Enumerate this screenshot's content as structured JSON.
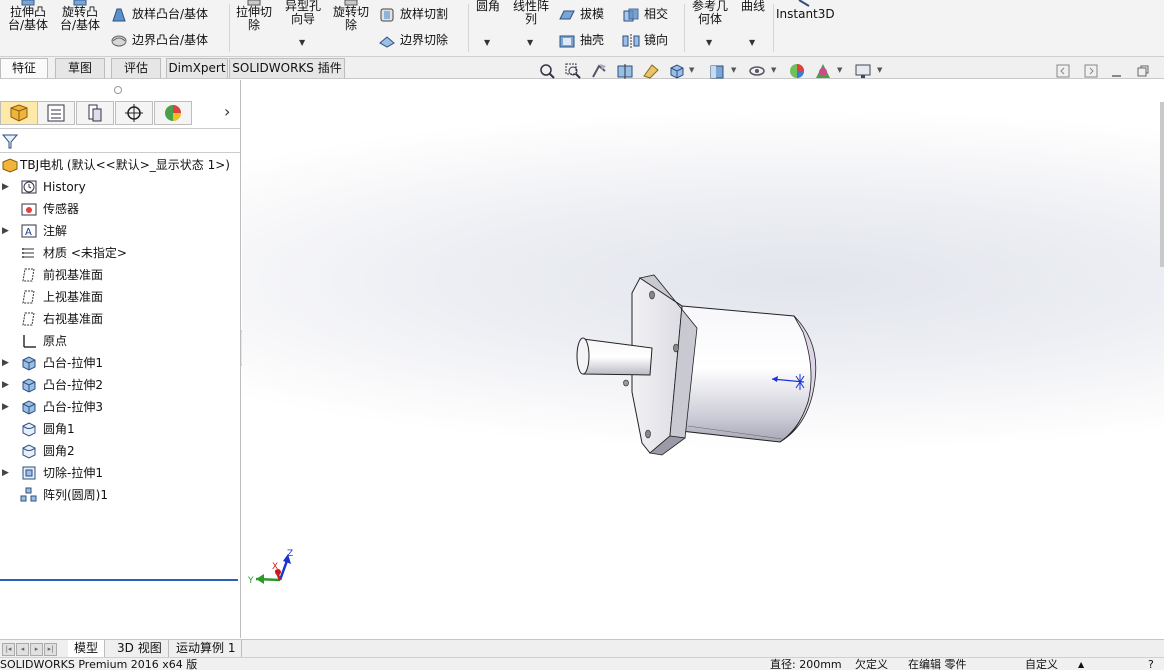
{
  "ribbon": {
    "extrude_boss": "拉伸凸台/基体",
    "revolve_boss": "旋转凸台/基体",
    "loft_boss": "放样凸台/基体",
    "boundary_boss": "边界凸台/基体",
    "extrude_cut": "拉伸切除",
    "hole_wizard": "异型孔向导",
    "revolve_cut": "旋转切除",
    "loft_cut": "放样切割",
    "boundary_cut": "边界切除",
    "fillet": "圆角",
    "linear_pattern": "线性阵列",
    "draft": "拔模",
    "shell": "抽壳",
    "intersect": "相交",
    "mirror": "镜向",
    "reference_geometry": "参考几何体",
    "curves": "曲线",
    "instant3d": "Instant3D"
  },
  "command_tabs": [
    "特征",
    "草图",
    "评估",
    "DimXpert",
    "SOLIDWORKS 插件"
  ],
  "feature_manager": {
    "root": "TBJ电机 (默认<<默认>_显示状态 1>)",
    "items": [
      {
        "label": "History",
        "expandable": true,
        "icon": "history-icon"
      },
      {
        "label": "传感器",
        "expandable": false,
        "icon": "sensor-icon"
      },
      {
        "label": "注解",
        "expandable": true,
        "icon": "annotation-icon"
      },
      {
        "label": "材质 <未指定>",
        "expandable": false,
        "icon": "material-icon"
      },
      {
        "label": "前视基准面",
        "expandable": false,
        "icon": "plane-icon"
      },
      {
        "label": "上视基准面",
        "expandable": false,
        "icon": "plane-icon"
      },
      {
        "label": "右视基准面",
        "expandable": false,
        "icon": "plane-icon"
      },
      {
        "label": "原点",
        "expandable": false,
        "icon": "origin-icon"
      },
      {
        "label": "凸台-拉伸1",
        "expandable": true,
        "icon": "boss-extrude-icon"
      },
      {
        "label": "凸台-拉伸2",
        "expandable": true,
        "icon": "boss-extrude-icon"
      },
      {
        "label": "凸台-拉伸3",
        "expandable": true,
        "icon": "boss-extrude-icon"
      },
      {
        "label": "圆角1",
        "expandable": false,
        "icon": "fillet-icon"
      },
      {
        "label": "圆角2",
        "expandable": false,
        "icon": "fillet-icon"
      },
      {
        "label": "切除-拉伸1",
        "expandable": true,
        "icon": "cut-extrude-icon"
      },
      {
        "label": "阵列(圆周)1",
        "expandable": false,
        "icon": "circular-pattern-icon"
      }
    ]
  },
  "triad": {
    "x": "X",
    "y": "Y",
    "z": "Z"
  },
  "bottom_tabs": [
    "模型",
    "3D 视图",
    "运动算例 1"
  ],
  "status": {
    "app": "SOLIDWORKS Premium 2016 x64 版",
    "dimension": "直径: 200mm",
    "undefined": "欠定义",
    "editing": "在编辑 零件",
    "custom": "自定义"
  },
  "colors": {
    "accent": "#2b5fb8",
    "tab_active": "#ffe9a8"
  }
}
